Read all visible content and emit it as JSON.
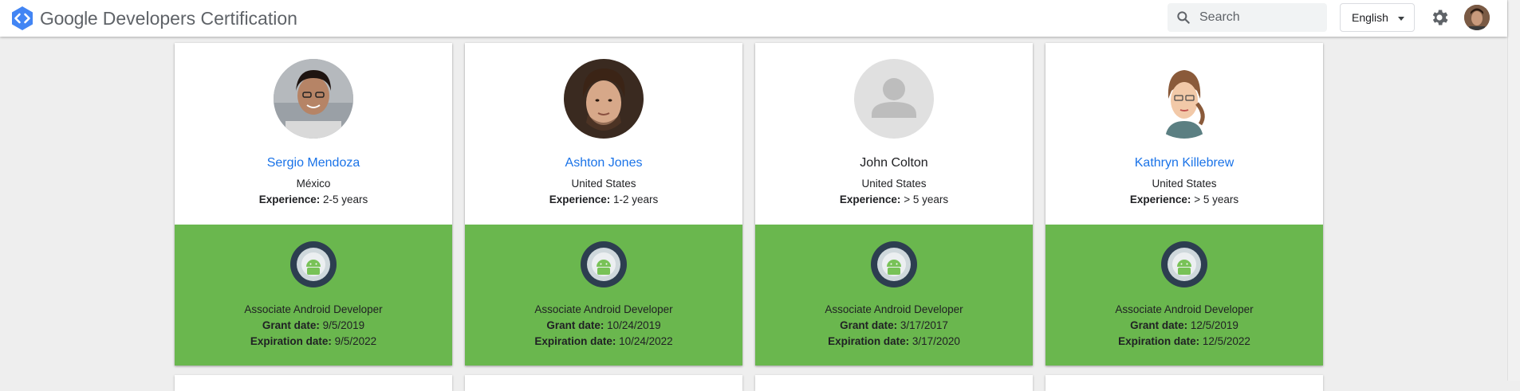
{
  "header": {
    "brand_google": "Google",
    "brand_rest": "Developers Certification",
    "search_placeholder": "Search",
    "language": "English"
  },
  "labels": {
    "experience": "Experience:",
    "grant": "Grant date:",
    "expiration": "Expiration date:"
  },
  "cards": [
    {
      "name": "Sergio Mendoza",
      "country": "México",
      "experience": "2-5 years",
      "certification": "Associate Android Developer",
      "grant_date": "9/5/2019",
      "expiration_date": "9/5/2022"
    },
    {
      "name": "Ashton Jones",
      "country": "United States",
      "experience": "1-2 years",
      "certification": "Associate Android Developer",
      "grant_date": "10/24/2019",
      "expiration_date": "10/24/2022"
    },
    {
      "name": "John Colton",
      "country": "United States",
      "experience": "> 5 years",
      "certification": "Associate Android Developer",
      "grant_date": "3/17/2017",
      "expiration_date": "3/17/2020"
    },
    {
      "name": "Kathryn Killebrew",
      "country": "United States",
      "experience": "> 5 years",
      "certification": "Associate Android Developer",
      "grant_date": "12/5/2019",
      "expiration_date": "12/5/2022"
    }
  ],
  "colors": {
    "accent": "#1a73e8",
    "card_green": "#6ab74e",
    "logo_blue": "#4285f4"
  }
}
